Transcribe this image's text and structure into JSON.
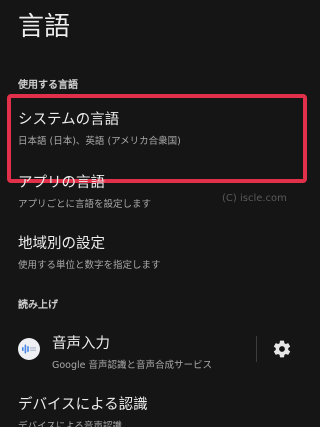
{
  "page": {
    "title": "言語"
  },
  "sections": {
    "used_languages": {
      "header": "使用する言語",
      "system_language": {
        "title": "システムの言語",
        "subtitle": "日本語 (日本)、英語 (アメリカ合衆国)"
      },
      "app_language": {
        "title": "アプリの言語",
        "subtitle": "アプリごとに言語を設定します"
      },
      "regional_settings": {
        "title": "地域別の設定",
        "subtitle": "使用する単位と数字を指定します"
      }
    },
    "read_aloud": {
      "header": "読み上げ",
      "voice_input": {
        "title": "音声入力",
        "subtitle": "Google 音声認識と音声合成サービス",
        "icon": "voice-input-icon",
        "settings_icon": "gear-icon"
      },
      "device_recognition": {
        "title": "デバイスによる認識",
        "subtitle": "デバイスによる音声認識"
      }
    }
  },
  "watermark": "(C) iscle.com",
  "colors": {
    "background": "#151515",
    "highlight": "#e0304a",
    "voice_icon_blue": "#4a86e8"
  }
}
